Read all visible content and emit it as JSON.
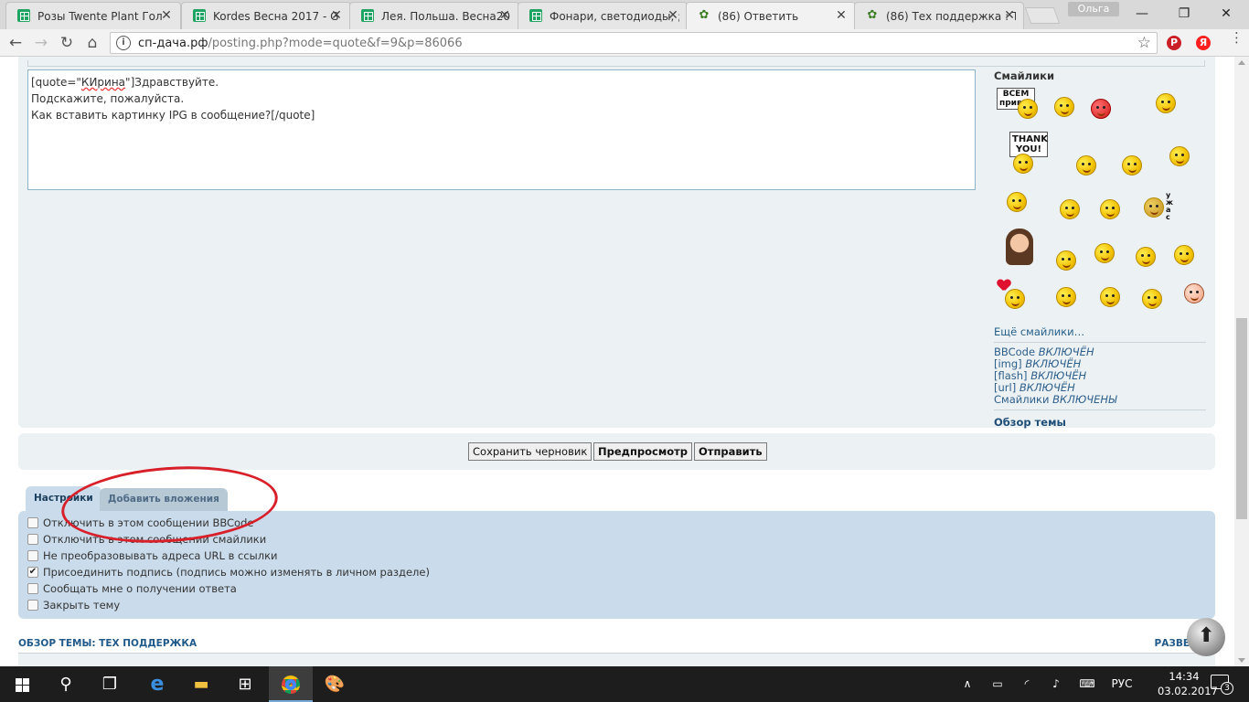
{
  "browser": {
    "tabs": [
      {
        "label": "Розы Twente Plant Гол",
        "icon": "sheets-icon"
      },
      {
        "label": "Kordes Весна 2017 - G",
        "icon": "sheets-icon"
      },
      {
        "label": "Лея. Польша. Весна20",
        "icon": "sheets-icon"
      },
      {
        "label": "Фонари, светодиоды, ;",
        "icon": "sheets-icon"
      },
      {
        "label": "(86) Ответить",
        "icon": "plant-icon",
        "active": true
      },
      {
        "label": "(86) Тех поддержка : Т",
        "icon": "plant-icon"
      }
    ],
    "profile_name": "Ольга",
    "url_domain": "сп-дача.рф",
    "url_path": "/posting.php?mode=quote&f=9&p=86066"
  },
  "editor": {
    "quote_open": "[quote=\"",
    "quote_author": "КИрина",
    "quote_line1_rest": "\"]Здравствуйте.",
    "line2": "Подскажите, пожалуйста.",
    "line3": "Как вставить картинку IPG в сообщение?[/quote]"
  },
  "smilies": {
    "title": "Смайлики",
    "sign_hello_1": "ВСЕМ",
    "sign_hello_2": "привет",
    "sign_thanks_1": "THANK",
    "sign_thanks_2": "YOU!",
    "sign_horror": "у\nж\nа\nс",
    "more_link": "Ещё смайлики…"
  },
  "status": {
    "bbcode_label": "BBCode",
    "bbcode_value": "ВКЛЮЧЁН",
    "img_label": "[img]",
    "img_value": "ВКЛЮЧЁН",
    "flash_label": "[flash]",
    "flash_value": "ВКЛЮЧЁН",
    "url_label": "[url]",
    "url_value": "ВКЛЮЧЁН",
    "smilies_label": "Смайлики",
    "smilies_value": "ВКЛЮЧЕНЫ",
    "topic_review_link": "Обзор темы"
  },
  "actions": {
    "save_draft": "Сохранить черновик",
    "preview": "Предпросмотр",
    "submit": "Отправить"
  },
  "option_tabs": {
    "settings": "Настройки",
    "attachments": "Добавить вложения"
  },
  "options": [
    {
      "label": "Отключить в этом сообщении BBCode",
      "checked": false
    },
    {
      "label": "Отключить в этом сообщении смайлики",
      "checked": false
    },
    {
      "label": "Не преобразовывать адреса URL в ссылки",
      "checked": false
    },
    {
      "label": "Присоединить подпись (подпись можно изменять в личном разделе)",
      "checked": true
    },
    {
      "label": "Сообщать мне о получении ответа",
      "checked": false
    },
    {
      "label": "Закрыть тему",
      "checked": false
    }
  ],
  "review": {
    "title": "ОБЗОР ТЕМЫ: ТЕХ ПОДДЕРЖКА",
    "expand": "РАЗВЕ"
  },
  "taskbar": {
    "language": "РУС",
    "time": "14:34",
    "date": "03.02.2017",
    "notifications": "3"
  },
  "colors": {
    "panel_bg": "#ecf1f3",
    "options_bg": "#cadceb",
    "link": "#245e8a",
    "annotation_red": "#d8202a"
  }
}
